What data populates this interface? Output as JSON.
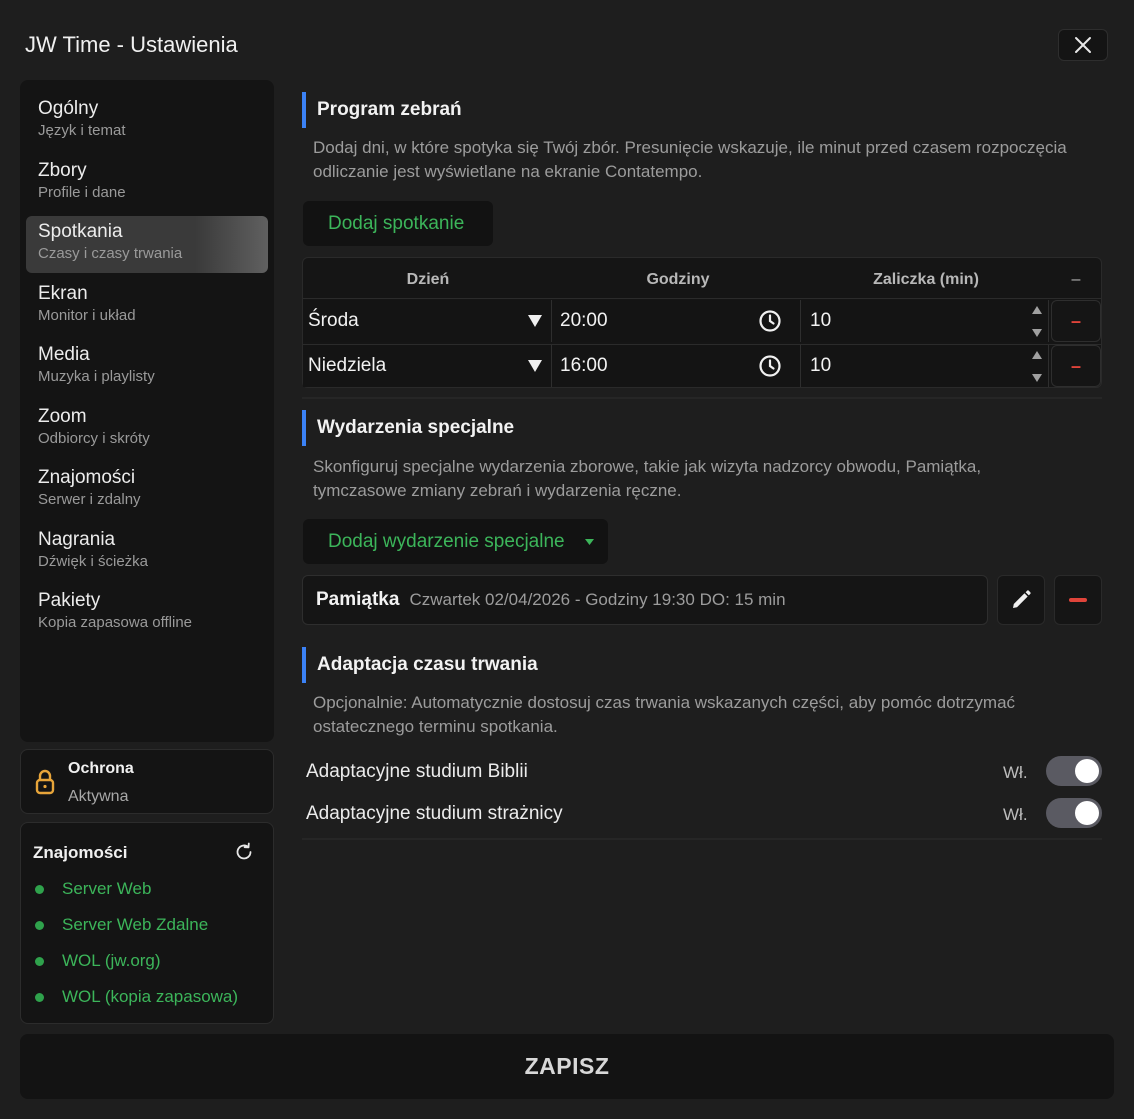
{
  "app": {
    "title": "JW Time - Ustawienia",
    "close_icon": "close-icon"
  },
  "sidebar": {
    "items": [
      {
        "title": "Ogólny",
        "subtitle": "Język i temat"
      },
      {
        "title": "Zbory",
        "subtitle": "Profile i dane"
      },
      {
        "title": "Spotkania",
        "subtitle": "Czasy i czasy trwania",
        "active": true
      },
      {
        "title": "Ekran",
        "subtitle": "Monitor i układ"
      },
      {
        "title": "Media",
        "subtitle": "Muzyka i playlisty"
      },
      {
        "title": "Zoom",
        "subtitle": "Odbiorcy i skróty"
      },
      {
        "title": "Znajomości",
        "subtitle": "Serwer i zdalny"
      },
      {
        "title": "Nagrania",
        "subtitle": "Dźwięk i ścieżka"
      },
      {
        "title": "Pakiety",
        "subtitle": "Kopia zapasowa offline"
      }
    ]
  },
  "protection": {
    "title": "Ochrona",
    "status": "Aktywna",
    "icon": "lock-icon",
    "color": "#e8a53a"
  },
  "connections": {
    "title": "Znajomości",
    "icon": "refresh-icon",
    "status_color": "#2fa24c",
    "items": [
      "Server Web",
      "Server Web Zdalne",
      "WOL (jw.org)",
      "WOL (kopia zapasowa)"
    ]
  },
  "meetings": {
    "title": "Program zebrań",
    "description": "Dodaj dni, w które spotyka się Twój zbór. Presunięcie wskazuje, ile minut przed czasem rozpoczęcia odliczanie jest wyświetlane na ekranie Contatempo.",
    "add_button": "Dodaj spotkanie",
    "columns": [
      "Dzień",
      "Godziny",
      "Zaliczka (min)",
      "–"
    ],
    "rows": [
      {
        "day": "Środa",
        "time": "20:00",
        "advance": "10",
        "remove": "–"
      },
      {
        "day": "Niedziela",
        "time": "16:00",
        "advance": "10",
        "remove": "–"
      }
    ]
  },
  "special": {
    "title": "Wydarzenia specjalne",
    "description": "Skonfiguruj specjalne wydarzenia zborowe, takie jak wizyta nadzorcy obwodu, Pamiątka, tymczasowe zmiany zebrań i wydarzenia ręczne.",
    "add_button": "Dodaj wydarzenie specjalne",
    "event": {
      "name": "Pamiątka",
      "info": "Czwartek 02/04/2026 - Godziny 19:30 DO: 15 min"
    }
  },
  "adaptation": {
    "title": "Adaptacja czasu trwania",
    "description": "Opcjonalnie: Automatycznie dostosuj czas trwania wskazanych części, aby pomóc dotrzymać ostatecznego terminu spotkania.",
    "toggles": [
      {
        "label": "Adaptacyjne studium Biblii",
        "state": "Wł.",
        "on": true
      },
      {
        "label": "Adaptacyjne studium strażnicy",
        "state": "Wł.",
        "on": true
      }
    ]
  },
  "save_button": "ZAPISZ",
  "colors": {
    "accent": "#3b82f6",
    "green": "#3cb55a",
    "remove": "#e0443a"
  }
}
